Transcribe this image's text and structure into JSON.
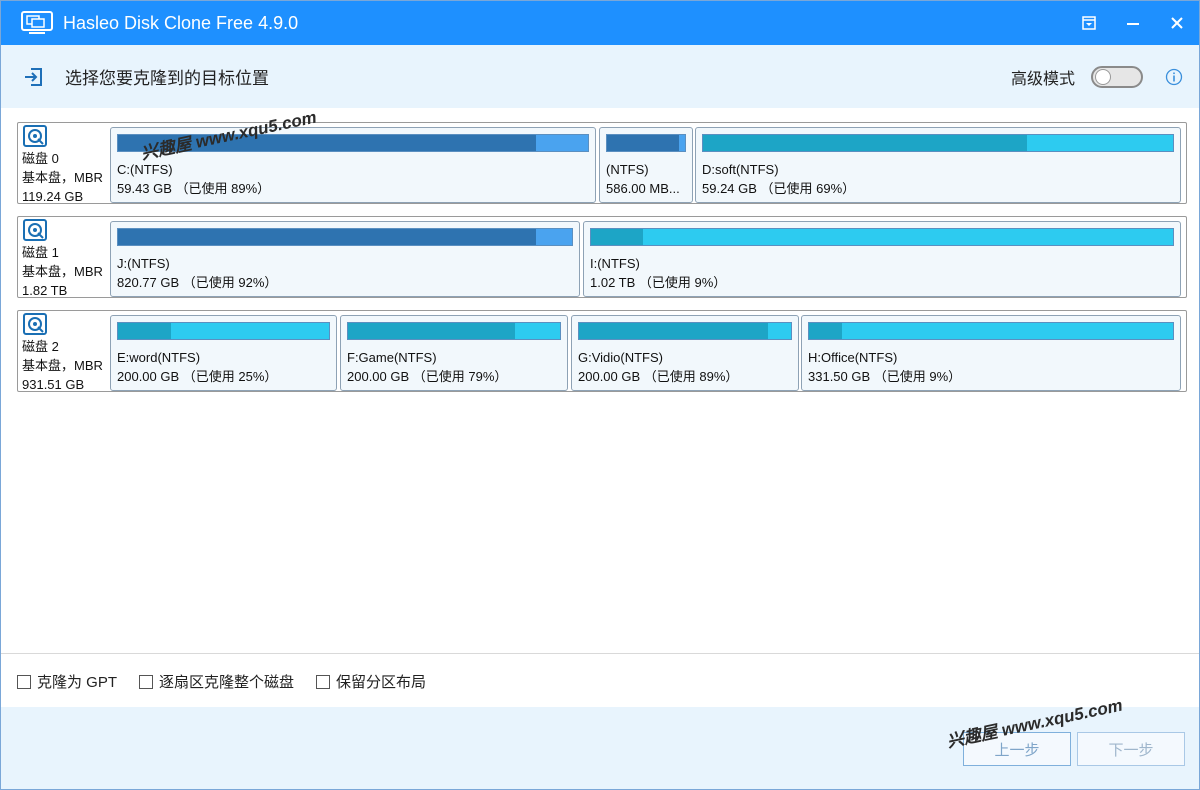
{
  "window": {
    "title": "Hasleo Disk Clone Free 4.9.0",
    "accent_color": "#1e90ff"
  },
  "header": {
    "title": "选择您要克隆到的目标位置",
    "advanced_mode_label": "高级模式",
    "advanced_mode_on": false
  },
  "disks": [
    {
      "name": "磁盘 0",
      "type": "基本盘，MBR",
      "size": "119.24 GB",
      "partitions": [
        {
          "label": "C:(NTFS)",
          "size_text": "59.43 GB （已使用 89%）",
          "used_fraction": 0.89,
          "color": "blue"
        },
        {
          "label": "(NTFS)",
          "size_text": "586.00 MB...",
          "used_fraction": 0.92,
          "color": "blue"
        },
        {
          "label": "D:soft(NTFS)",
          "size_text": "59.24 GB （已使用 69%）",
          "used_fraction": 0.69,
          "color": "cyan"
        }
      ]
    },
    {
      "name": "磁盘 1",
      "type": "基本盘，MBR",
      "size": "1.82 TB",
      "partitions": [
        {
          "label": "J:(NTFS)",
          "size_text": "820.77 GB （已使用 92%）",
          "used_fraction": 0.92,
          "color": "blue"
        },
        {
          "label": "I:(NTFS)",
          "size_text": "1.02 TB （已使用 9%）",
          "used_fraction": 0.09,
          "color": "cyan"
        }
      ]
    },
    {
      "name": "磁盘 2",
      "type": "基本盘，MBR",
      "size": "931.51 GB",
      "partitions": [
        {
          "label": "E:word(NTFS)",
          "size_text": "200.00 GB （已使用 25%）",
          "used_fraction": 0.25,
          "color": "cyan"
        },
        {
          "label": "F:Game(NTFS)",
          "size_text": "200.00 GB （已使用 79%）",
          "used_fraction": 0.79,
          "color": "cyan"
        },
        {
          "label": "G:Vidio(NTFS)",
          "size_text": "200.00 GB （已使用 89%）",
          "used_fraction": 0.89,
          "color": "cyan"
        },
        {
          "label": "H:Office(NTFS)",
          "size_text": "331.50 GB （已使用 9%）",
          "used_fraction": 0.09,
          "color": "cyan"
        }
      ]
    }
  ],
  "options": {
    "clone_gpt": "克隆为 GPT",
    "sector_clone": "逐扇区克隆整个磁盘",
    "keep_layout": "保留分区布局"
  },
  "buttons": {
    "prev": "上一步",
    "next": "下一步"
  },
  "watermark": {
    "text": "兴趣屋 www.xqu5.com"
  }
}
